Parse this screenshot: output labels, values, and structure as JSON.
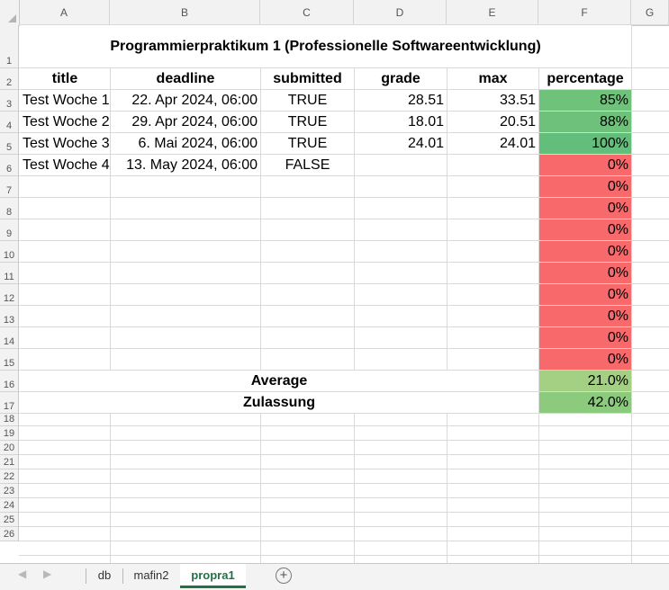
{
  "columns": [
    "A",
    "B",
    "C",
    "D",
    "E",
    "F",
    "G"
  ],
  "rows": [
    "1",
    "2",
    "3",
    "4",
    "5",
    "6",
    "7",
    "8",
    "9",
    "10",
    "11",
    "12",
    "13",
    "14",
    "15",
    "16",
    "17",
    "18",
    "19",
    "20",
    "21",
    "22",
    "23",
    "24",
    "25",
    "26"
  ],
  "title": "Programmierpraktikum 1 (Professionelle Softwareentwicklung)",
  "headers": {
    "title": "title",
    "deadline": "deadline",
    "submitted": "submitted",
    "grade": "grade",
    "max": "max",
    "percentage": "percentage"
  },
  "data_rows": [
    {
      "title": "Test Woche 1",
      "deadline": "22. Apr 2024, 06:00",
      "submitted": "TRUE",
      "grade": "28.51",
      "max": "33.51",
      "percentage": "85%",
      "pct_color": "#6fc27a"
    },
    {
      "title": "Test Woche 2",
      "deadline": "29. Apr 2024, 06:00",
      "submitted": "TRUE",
      "grade": "18.01",
      "max": "20.51",
      "percentage": "88%",
      "pct_color": "#6ec17a"
    },
    {
      "title": "Test Woche 3",
      "deadline": "6. Mai 2024, 06:00",
      "submitted": "TRUE",
      "grade": "24.01",
      "max": "24.01",
      "percentage": "100%",
      "pct_color": "#63be7b"
    },
    {
      "title": "Test Woche 4",
      "deadline": "13. May 2024, 06:00",
      "submitted": "FALSE",
      "grade": "",
      "max": "",
      "percentage": "0%",
      "pct_color": "#f8696b"
    }
  ],
  "empty_percentages": [
    "0%",
    "0%",
    "0%",
    "0%",
    "0%",
    "0%",
    "0%",
    "0%",
    "0%"
  ],
  "empty_pct_color": "#f8696b",
  "summary": [
    {
      "label": "Average",
      "value": "21.0%",
      "color": "#a4d083"
    },
    {
      "label": "Zulassung",
      "value": "42.0%",
      "color": "#8ccb7e"
    }
  ],
  "sheet_tabs": [
    {
      "label": "db",
      "active": false
    },
    {
      "label": "mafin2",
      "active": false
    },
    {
      "label": "propra1",
      "active": true
    }
  ],
  "add_sheet_symbol": "+",
  "nav_prev": "◀",
  "nav_next": "▶"
}
